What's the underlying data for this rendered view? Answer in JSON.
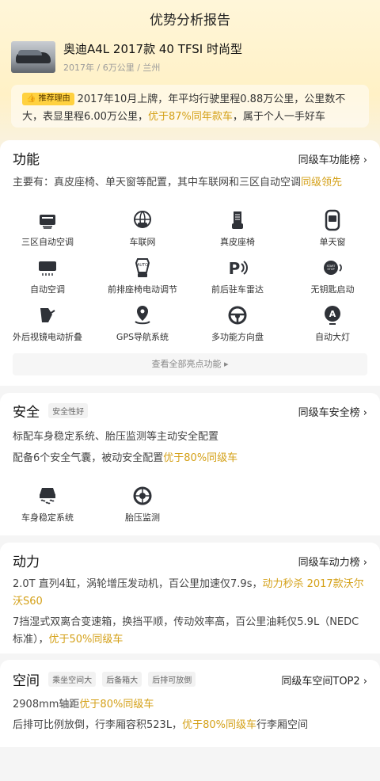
{
  "header": {
    "title": "优势分析报告"
  },
  "car": {
    "name": "奥迪A4L 2017款 40 TFSI 时尚型",
    "meta": "2017年 / 6万公里 / 兰州"
  },
  "reason": {
    "badge": "推荐理由",
    "text_part1": "2017年10月上牌，年平均行驶里程0.88万公里，公里数不大，表显里程6.00万公里，",
    "highlight": "优于87%同年款车",
    "text_part2": "，属于个人一手好车"
  },
  "function": {
    "title": "功能",
    "link": "同级车功能榜 ›",
    "summary_part1": "主要有：真皮座椅、单天窗等配置，其中车联网和三区自动空调",
    "summary_highlight": "同级领先",
    "features": [
      {
        "label": "三区自动空调",
        "icon": "climate-icon"
      },
      {
        "label": "车联网",
        "icon": "car-connect-icon"
      },
      {
        "label": "真皮座椅",
        "icon": "seat-icon"
      },
      {
        "label": "单天窗",
        "icon": "sunroof-icon"
      },
      {
        "label": "自动空调",
        "icon": "ac-icon"
      },
      {
        "label": "前排座椅电动调节",
        "icon": "seat-adjust-icon"
      },
      {
        "label": "前后驻车雷达",
        "icon": "parking-radar-icon"
      },
      {
        "label": "无钥匙启动",
        "icon": "keyless-start-icon"
      },
      {
        "label": "外后视镜电动折叠",
        "icon": "mirror-fold-icon"
      },
      {
        "label": "GPS导航系统",
        "icon": "gps-icon"
      },
      {
        "label": "多功能方向盘",
        "icon": "steering-wheel-icon"
      },
      {
        "label": "自动大灯",
        "icon": "auto-headlight-icon"
      }
    ],
    "more": "查看全部亮点功能 ▸"
  },
  "safety": {
    "title": "安全",
    "tag": "安全性好",
    "link": "同级车安全榜 ›",
    "line1": "标配车身稳定系统、胎压监测等主动安全配置",
    "line2_part1": "配备6个安全气囊，被动安全配置",
    "line2_highlight": "优于80%同级车",
    "features": [
      {
        "label": "车身稳定系统",
        "icon": "stability-icon"
      },
      {
        "label": "胎压监测",
        "icon": "tire-pressure-icon"
      }
    ]
  },
  "power": {
    "title": "动力",
    "link": "同级车动力榜 ›",
    "line1_part1": "2.0T 直列4缸，涡轮增压发动机，百公里加速仅7.9s，",
    "line1_highlight": "动力秒杀 2017款沃尔沃S60",
    "line2_part1": "7挡湿式双离合变速箱，换挡平顺，传动效率高，百公里油耗仅5.9L（NEDC标准），",
    "line2_highlight": "优于50%同级车"
  },
  "space": {
    "title": "空间",
    "tags": [
      "乘坐空间大",
      "后备箱大",
      "后排可放倒"
    ],
    "link": "同级车空间TOP2 ›",
    "line1_part1": "2908mm轴距",
    "line1_highlight": "优于80%同级车",
    "line2_part1": "后排可比例放倒，行李厢容积523L，",
    "line2_highlight": "优于80%同级车",
    "line2_part2": "行李厢空间"
  },
  "colors": {
    "accent": "#d4a017",
    "badge": "#ffd13f"
  }
}
